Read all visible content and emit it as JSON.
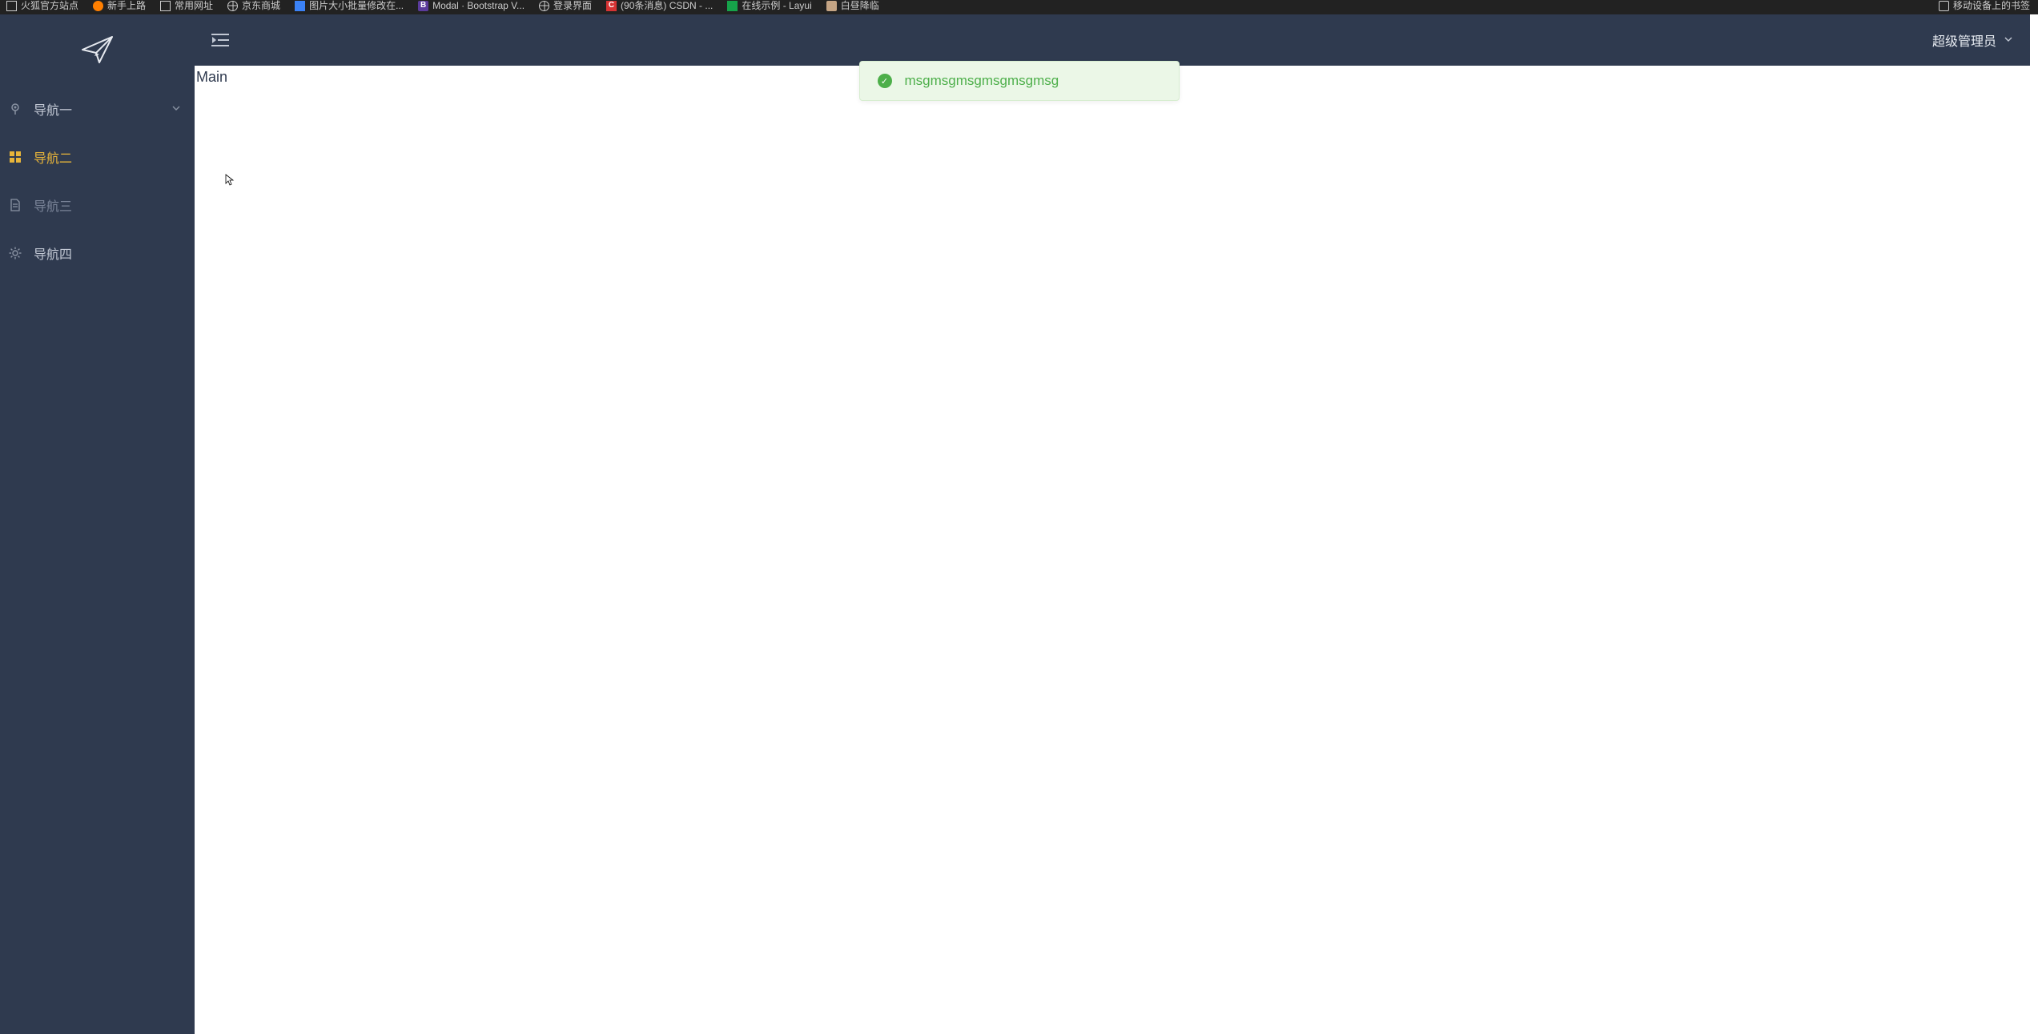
{
  "bookmarks": {
    "items": [
      {
        "label": "火狐官方站点",
        "icon": "rect"
      },
      {
        "label": "新手上路",
        "icon": "orange"
      },
      {
        "label": "常用网址",
        "icon": "rect"
      },
      {
        "label": "京东商城",
        "icon": "globe"
      },
      {
        "label": "图片大小批量修改在...",
        "icon": "blue"
      },
      {
        "label": "Modal · Bootstrap V...",
        "icon": "purpleB",
        "badge": "B"
      },
      {
        "label": "登录界面",
        "icon": "globe"
      },
      {
        "label": "(90条消息) CSDN - ...",
        "icon": "redC",
        "badge": "C"
      },
      {
        "label": "在线示例 - Layui",
        "icon": "green"
      },
      {
        "label": "白昼降临",
        "icon": "lightbrown"
      }
    ],
    "right": {
      "label": "移动设备上的书签",
      "icon": "device"
    }
  },
  "sidebar": {
    "items": [
      {
        "label": "导航一",
        "icon": "pin",
        "expandable": true
      },
      {
        "label": "导航二",
        "icon": "grid"
      },
      {
        "label": "导航三",
        "icon": "doc"
      },
      {
        "label": "导航四",
        "icon": "gear"
      }
    ],
    "active_index": 1
  },
  "topbar": {
    "user_label": "超级管理员"
  },
  "toast": {
    "message": "msgmsgmsgmsgmsgmsg"
  },
  "content": {
    "main_label": "Main"
  },
  "colors": {
    "sidebar_bg": "#2f3a4f",
    "active": "#e8b53a",
    "toast_bg": "#ebf7e7",
    "toast_fg": "#4daf4a"
  }
}
